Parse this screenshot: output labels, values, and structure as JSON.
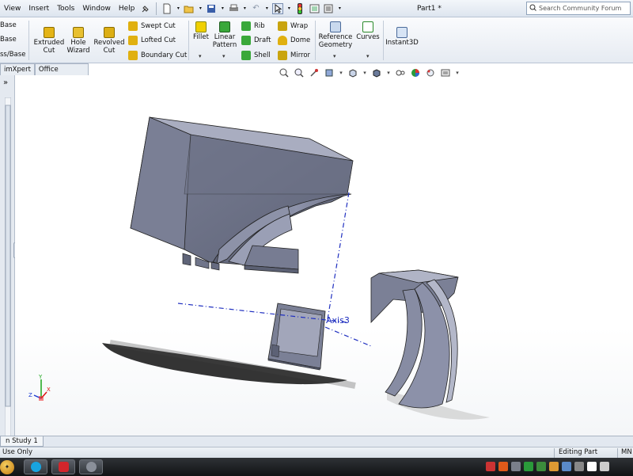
{
  "menubar": {
    "items": [
      "View",
      "Insert",
      "Tools",
      "Window",
      "Help"
    ],
    "document_title": "Part1 *",
    "search_placeholder": "Search Community Forum"
  },
  "command_manager": {
    "partial_left": [
      "Base",
      "Base",
      "ss/Base"
    ],
    "extruded_cut": "Extruded\nCut",
    "hole_wizard": "Hole\nWizard",
    "revolved_cut": "Revolved\nCut",
    "swept_cut": "Swept Cut",
    "lofted_cut": "Lofted Cut",
    "boundary_cut": "Boundary Cut",
    "fillet": "Fillet",
    "linear_pattern": "Linear\nPattern",
    "rib": "Rib",
    "draft": "Draft",
    "shell": "Shell",
    "wrap": "Wrap",
    "dome": "Dome",
    "mirror": "Mirror",
    "reference_geometry": "Reference\nGeometry",
    "curves": "Curves",
    "instant3d": "Instant3D"
  },
  "tabs": [
    "imXpert",
    "Office Products"
  ],
  "viewport": {
    "axis_label": "Axis3",
    "triad": {
      "x": "X",
      "y": "Y",
      "z": "Z"
    }
  },
  "bottom_tab": "n Study 1",
  "status": {
    "left": "Use Only",
    "mode": "Editing Part",
    "units": "MN"
  },
  "colors": {
    "model_face": "#6e7388",
    "model_side": "#8a8fa6",
    "model_top": "#a7abbf",
    "axis": "#1f2fc0"
  },
  "icons": [
    "new-icon",
    "open-icon",
    "save-icon",
    "print-icon",
    "undo-icon",
    "select-icon",
    "rebuild-icon",
    "options-icon"
  ]
}
